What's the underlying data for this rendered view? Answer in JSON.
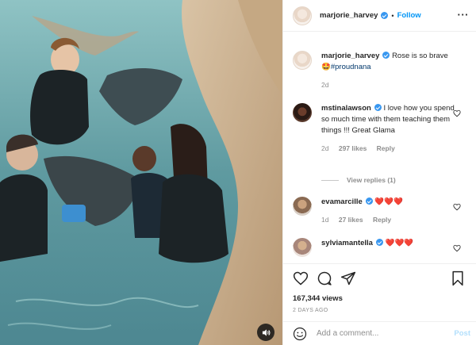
{
  "header": {
    "username": "marjorie_harvey",
    "separator": "•",
    "follow_label": "Follow",
    "more_icon": "more-dots-icon"
  },
  "caption": {
    "username": "marjorie_harvey",
    "text": "Rose is so brave",
    "emoji": "🤩",
    "hashtag": "#proudnana",
    "time": "2d"
  },
  "comments": [
    {
      "username": "mstinalawson",
      "text": "I love how you spend so much time with them teaching them things !!! Great Glama",
      "time": "2d",
      "likes": "297 likes",
      "reply": "Reply",
      "view_replies": "View replies (1)"
    },
    {
      "username": "evamarcille",
      "text": "❤️❤️❤️",
      "time": "1d",
      "likes": "27 likes",
      "reply": "Reply"
    },
    {
      "username": "sylviamantella",
      "text": "❤️❤️❤️"
    }
  ],
  "actions": {
    "likes": "167,344 views",
    "timestamp": "2 DAYS AGO"
  },
  "composer": {
    "placeholder": "Add a comment...",
    "post_label": "Post"
  },
  "colors": {
    "accent": "#0095f6",
    "verified": "#3897f0",
    "heart": "#ed4956",
    "muted_text": "#8e8e8e"
  }
}
